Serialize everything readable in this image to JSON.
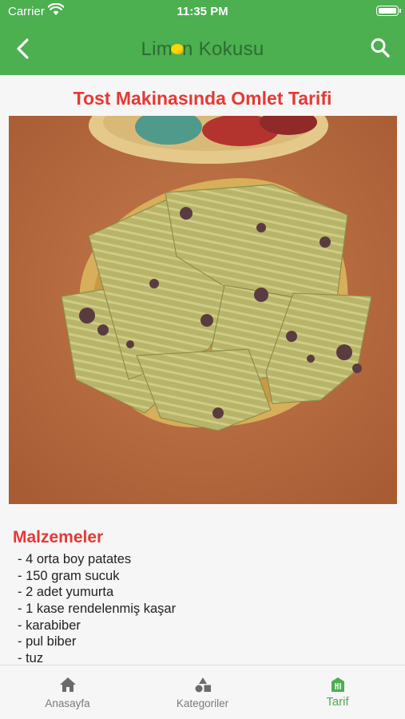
{
  "status_bar": {
    "carrier": "Carrier",
    "time": "11:35 PM"
  },
  "header": {
    "logo_left": "Lim",
    "logo_right": "n Kokusu",
    "accent_color": "#4caf50"
  },
  "recipe": {
    "title": "Tost Makinasında Omlet Tarifi",
    "ingredients_heading": "Malzemeler",
    "ingredients": [
      "- 4 orta boy patates",
      "- 150 gram sucuk",
      "- 2 adet yumurta",
      "- 1 kase rendelenmiş kaşar",
      "- karabiber",
      "- pul biber",
      "- tuz"
    ]
  },
  "tabs": [
    {
      "label": "Anasayfa",
      "icon": "home-icon"
    },
    {
      "label": "Kategoriler",
      "icon": "shapes-icon"
    },
    {
      "label": "Tarif",
      "icon": "recipe-icon",
      "active": true
    }
  ]
}
